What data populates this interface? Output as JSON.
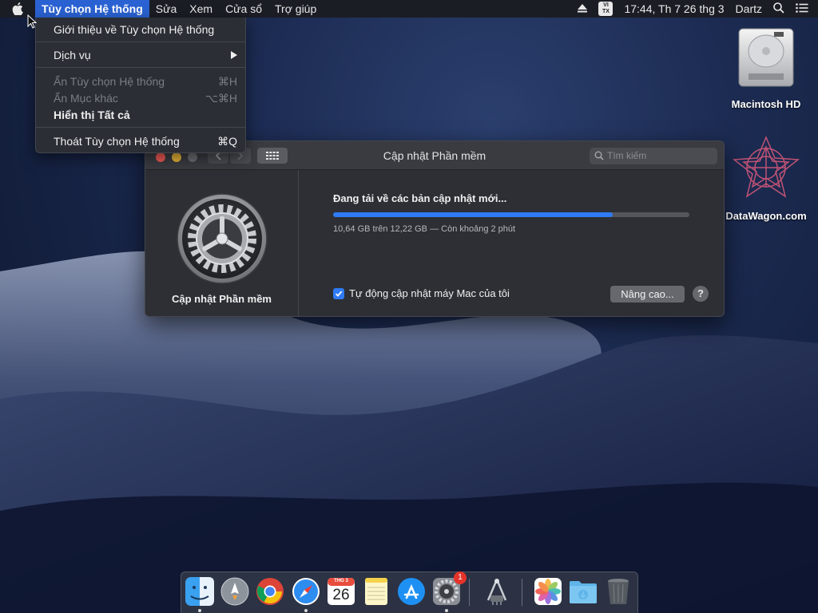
{
  "menubar": {
    "app_name": "Tùy chọn Hệ thống",
    "items": [
      "Sửa",
      "Xem",
      "Cửa sổ",
      "Trợ giúp"
    ],
    "input_badge_top": "VI",
    "input_badge_bottom": "TX",
    "clock": "17:44, Th 7 26 thg 3",
    "user": "Dartz"
  },
  "dropdown": {
    "about": "Giới thiệu về Tùy chọn Hệ thống",
    "services": "Dịch vụ",
    "hide": "Ẩn Tùy chọn Hệ thống",
    "hide_shortcut": "⌘H",
    "hide_others": "Ẩn Mục khác",
    "hide_others_shortcut": "⌥⌘H",
    "show_all": "Hiển thị Tất cả",
    "quit": "Thoát Tùy chọn Hệ thống",
    "quit_shortcut": "⌘Q"
  },
  "window": {
    "title": "Cập nhật Phần mềm",
    "search_placeholder": "Tìm kiếm",
    "pane_caption": "Cập nhật Phần mềm",
    "status": "Đang tải về các bản cập nhật mới...",
    "progress_fraction": 0.785,
    "detail": "10,64 GB trên 12,22 GB — Còn khoảng 2 phút",
    "auto_update_label": "Tự động cập nhật máy Mac của tôi",
    "auto_update_checked": true,
    "advanced_button": "Nâng cao...",
    "help_button": "?"
  },
  "desktop": {
    "icons": [
      {
        "label": "Macintosh HD",
        "icon": "hard-drive-icon"
      },
      {
        "label": "DataWagon.com",
        "icon": "datawagon-logo-icon"
      }
    ]
  },
  "dock": {
    "items": [
      {
        "name": "finder-icon",
        "running": true
      },
      {
        "name": "launchpad-icon",
        "running": false
      },
      {
        "name": "chrome-icon",
        "running": false
      },
      {
        "name": "safari-icon",
        "running": true
      },
      {
        "name": "calendar-icon",
        "running": false,
        "month": "THG 3",
        "day": "26"
      },
      {
        "name": "notes-icon",
        "running": false
      },
      {
        "name": "app-store-icon",
        "running": false
      },
      {
        "name": "system-preferences-icon",
        "running": true,
        "badge": "1"
      },
      {
        "name": "network-utility-icon",
        "running": false
      },
      {
        "name": "photos-icon",
        "running": false
      },
      {
        "name": "downloads-folder-icon",
        "running": false
      },
      {
        "name": "trash-icon",
        "running": false
      }
    ]
  },
  "colors": {
    "accent": "#2f7bf5",
    "menu_highlight": "#2a62d3"
  }
}
